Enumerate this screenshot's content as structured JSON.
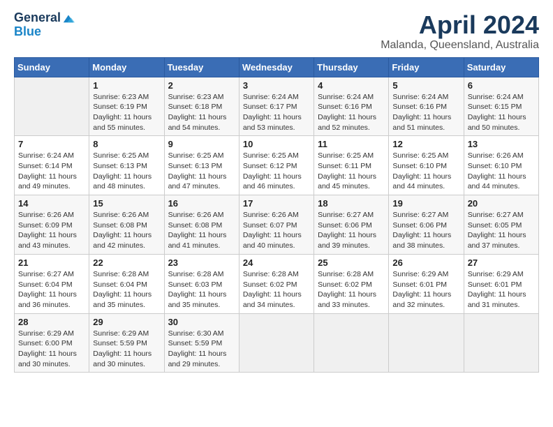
{
  "header": {
    "logo_general": "General",
    "logo_blue": "Blue",
    "month_title": "April 2024",
    "location": "Malanda, Queensland, Australia"
  },
  "days_of_week": [
    "Sunday",
    "Monday",
    "Tuesday",
    "Wednesday",
    "Thursday",
    "Friday",
    "Saturday"
  ],
  "weeks": [
    [
      {
        "day": "",
        "info": ""
      },
      {
        "day": "1",
        "info": "Sunrise: 6:23 AM\nSunset: 6:19 PM\nDaylight: 11 hours\nand 55 minutes."
      },
      {
        "day": "2",
        "info": "Sunrise: 6:23 AM\nSunset: 6:18 PM\nDaylight: 11 hours\nand 54 minutes."
      },
      {
        "day": "3",
        "info": "Sunrise: 6:24 AM\nSunset: 6:17 PM\nDaylight: 11 hours\nand 53 minutes."
      },
      {
        "day": "4",
        "info": "Sunrise: 6:24 AM\nSunset: 6:16 PM\nDaylight: 11 hours\nand 52 minutes."
      },
      {
        "day": "5",
        "info": "Sunrise: 6:24 AM\nSunset: 6:16 PM\nDaylight: 11 hours\nand 51 minutes."
      },
      {
        "day": "6",
        "info": "Sunrise: 6:24 AM\nSunset: 6:15 PM\nDaylight: 11 hours\nand 50 minutes."
      }
    ],
    [
      {
        "day": "7",
        "info": "Sunrise: 6:24 AM\nSunset: 6:14 PM\nDaylight: 11 hours\nand 49 minutes."
      },
      {
        "day": "8",
        "info": "Sunrise: 6:25 AM\nSunset: 6:13 PM\nDaylight: 11 hours\nand 48 minutes."
      },
      {
        "day": "9",
        "info": "Sunrise: 6:25 AM\nSunset: 6:13 PM\nDaylight: 11 hours\nand 47 minutes."
      },
      {
        "day": "10",
        "info": "Sunrise: 6:25 AM\nSunset: 6:12 PM\nDaylight: 11 hours\nand 46 minutes."
      },
      {
        "day": "11",
        "info": "Sunrise: 6:25 AM\nSunset: 6:11 PM\nDaylight: 11 hours\nand 45 minutes."
      },
      {
        "day": "12",
        "info": "Sunrise: 6:25 AM\nSunset: 6:10 PM\nDaylight: 11 hours\nand 44 minutes."
      },
      {
        "day": "13",
        "info": "Sunrise: 6:26 AM\nSunset: 6:10 PM\nDaylight: 11 hours\nand 44 minutes."
      }
    ],
    [
      {
        "day": "14",
        "info": "Sunrise: 6:26 AM\nSunset: 6:09 PM\nDaylight: 11 hours\nand 43 minutes."
      },
      {
        "day": "15",
        "info": "Sunrise: 6:26 AM\nSunset: 6:08 PM\nDaylight: 11 hours\nand 42 minutes."
      },
      {
        "day": "16",
        "info": "Sunrise: 6:26 AM\nSunset: 6:08 PM\nDaylight: 11 hours\nand 41 minutes."
      },
      {
        "day": "17",
        "info": "Sunrise: 6:26 AM\nSunset: 6:07 PM\nDaylight: 11 hours\nand 40 minutes."
      },
      {
        "day": "18",
        "info": "Sunrise: 6:27 AM\nSunset: 6:06 PM\nDaylight: 11 hours\nand 39 minutes."
      },
      {
        "day": "19",
        "info": "Sunrise: 6:27 AM\nSunset: 6:06 PM\nDaylight: 11 hours\nand 38 minutes."
      },
      {
        "day": "20",
        "info": "Sunrise: 6:27 AM\nSunset: 6:05 PM\nDaylight: 11 hours\nand 37 minutes."
      }
    ],
    [
      {
        "day": "21",
        "info": "Sunrise: 6:27 AM\nSunset: 6:04 PM\nDaylight: 11 hours\nand 36 minutes."
      },
      {
        "day": "22",
        "info": "Sunrise: 6:28 AM\nSunset: 6:04 PM\nDaylight: 11 hours\nand 35 minutes."
      },
      {
        "day": "23",
        "info": "Sunrise: 6:28 AM\nSunset: 6:03 PM\nDaylight: 11 hours\nand 35 minutes."
      },
      {
        "day": "24",
        "info": "Sunrise: 6:28 AM\nSunset: 6:02 PM\nDaylight: 11 hours\nand 34 minutes."
      },
      {
        "day": "25",
        "info": "Sunrise: 6:28 AM\nSunset: 6:02 PM\nDaylight: 11 hours\nand 33 minutes."
      },
      {
        "day": "26",
        "info": "Sunrise: 6:29 AM\nSunset: 6:01 PM\nDaylight: 11 hours\nand 32 minutes."
      },
      {
        "day": "27",
        "info": "Sunrise: 6:29 AM\nSunset: 6:01 PM\nDaylight: 11 hours\nand 31 minutes."
      }
    ],
    [
      {
        "day": "28",
        "info": "Sunrise: 6:29 AM\nSunset: 6:00 PM\nDaylight: 11 hours\nand 30 minutes."
      },
      {
        "day": "29",
        "info": "Sunrise: 6:29 AM\nSunset: 5:59 PM\nDaylight: 11 hours\nand 30 minutes."
      },
      {
        "day": "30",
        "info": "Sunrise: 6:30 AM\nSunset: 5:59 PM\nDaylight: 11 hours\nand 29 minutes."
      },
      {
        "day": "",
        "info": ""
      },
      {
        "day": "",
        "info": ""
      },
      {
        "day": "",
        "info": ""
      },
      {
        "day": "",
        "info": ""
      }
    ]
  ]
}
